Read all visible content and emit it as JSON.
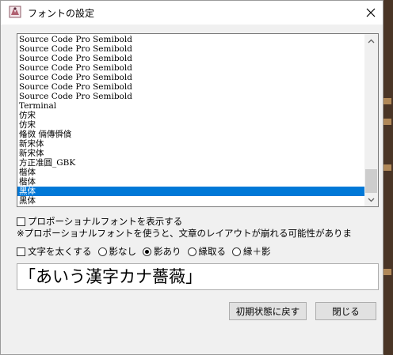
{
  "window": {
    "title": "フォントの設定"
  },
  "font_list": {
    "items": [
      "Source Code Pro Semibold",
      "Source Code Pro Semibold",
      "Source Code Pro Semibold",
      "Source Code Pro Semibold",
      "Source Code Pro Semibold",
      "Source Code Pro Semibold",
      "Source Code Pro Semibold",
      "Terminal",
      "仿宋",
      "仿宋",
      "偹傚 倆傳僢僋",
      "新宋体",
      "新宋体",
      "方正准圆_GBK",
      "楷体",
      "楷体",
      "黑体",
      "黑体"
    ],
    "selected_index": 16
  },
  "options": {
    "show_proportional_label": "プロポーショナルフォントを表示する",
    "proportional_note": "※プロポーショナルフォントを使うと、文章のレイアウトが崩れる可能性がありま",
    "bold_label": "文字を太くする",
    "effects": [
      {
        "label": "影なし",
        "selected": false
      },
      {
        "label": "影あり",
        "selected": true
      },
      {
        "label": "縁取る",
        "selected": false
      },
      {
        "label": "縁＋影",
        "selected": false
      }
    ]
  },
  "preview": {
    "text": "「あいう漢字カナ薔薇」"
  },
  "buttons": {
    "reset_label": "初期状態に戻す",
    "close_label": "閉じる"
  }
}
